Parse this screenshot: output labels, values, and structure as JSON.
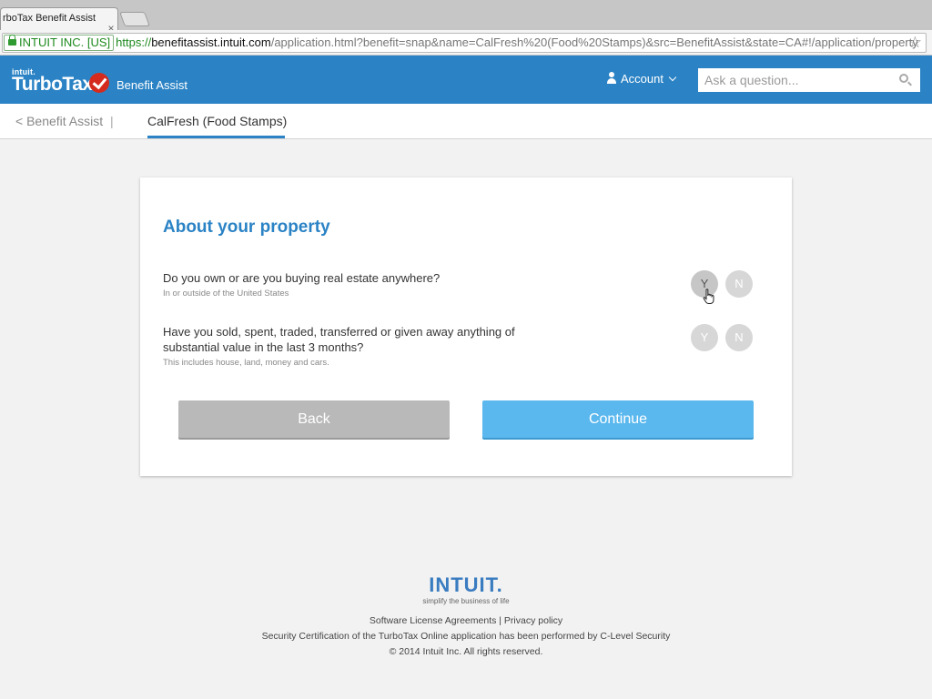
{
  "browser": {
    "tab_title": "rboTax Benefit Assist",
    "tab_close": "×",
    "ev_label": "INTUIT INC. [US]",
    "url_scheme": "https://",
    "url_host": "benefitassist.intuit.com",
    "url_rest": "/application.html?benefit=snap&name=CalFresh%20(Food%20Stamps)&src=BenefitAssist&state=CA#!/application/property",
    "star": "☆"
  },
  "header": {
    "logo_small": "intuit.",
    "logo_brand": "TurboTax",
    "logo_product": "Benefit Assist",
    "account_label": "Account",
    "search_placeholder": "Ask a question..."
  },
  "subnav": {
    "back_label": "< Benefit Assist",
    "separator": "|",
    "active_tab": "CalFresh (Food Stamps)"
  },
  "card": {
    "title": "About your property",
    "questions": [
      {
        "text": "Do you own or are you buying real estate anywhere?",
        "hint": "In or outside of the United States",
        "yes": "Y",
        "no": "N"
      },
      {
        "text": "Have you sold, spent, traded, transferred or given away anything of substantial value in the last 3 months?",
        "hint": "This includes house, land, money and cars.",
        "yes": "Y",
        "no": "N"
      }
    ],
    "back_button": "Back",
    "continue_button": "Continue"
  },
  "footer": {
    "brand": "INTUIT.",
    "tagline": "simplify the business of life",
    "links": "Software License Agreements | Privacy policy",
    "security": "Security Certification of the TurboTax Online application has been performed by C-Level Security",
    "copyright": "© 2014 Intuit Inc. All rights reserved."
  },
  "colors": {
    "header_blue": "#2b83c5",
    "continue_blue": "#5ab8ee",
    "back_gray": "#b9b9b9",
    "checkmark_red": "#d52b1e"
  }
}
